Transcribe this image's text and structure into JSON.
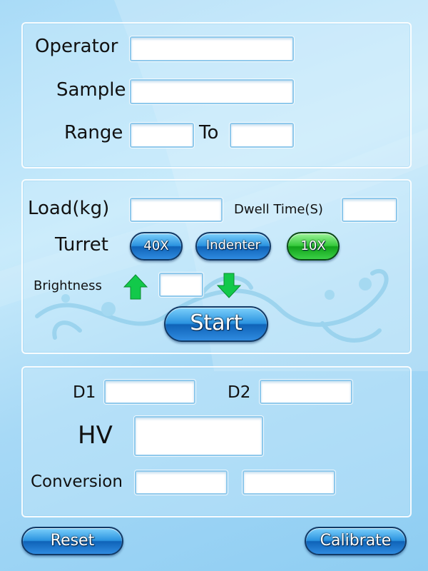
{
  "colors": {
    "background": "#a9dbf7",
    "button_blue": "#2b93e0",
    "button_green": "#35c93b",
    "arrow_green": "#12c94a"
  },
  "setup": {
    "operator_label": "Operator",
    "operator_value": "",
    "sample_label": "Sample",
    "sample_value": "",
    "range_label": "Range",
    "range_from_value": "",
    "range_to_label": "To",
    "range_to_value": ""
  },
  "controls": {
    "load_label": "Load(kg)",
    "load_value": "",
    "dwell_label": "Dwell Time(S)",
    "dwell_value": "",
    "turret_label": "Turret",
    "turret_buttons": [
      "40X",
      "Indenter",
      "10X"
    ],
    "turret_active": "10X",
    "brightness_label": "Brightness",
    "brightness_value": "",
    "brightness_up_icon": "arrow-up-icon",
    "brightness_down_icon": "arrow-down-icon",
    "start_label": "Start"
  },
  "results": {
    "d1_label": "D1",
    "d1_value": "",
    "d2_label": "D2",
    "d2_value": "",
    "hv_label": "HV",
    "hv_value": "",
    "conversion_label": "Conversion",
    "conversion_value_1": "",
    "conversion_value_2": ""
  },
  "footer": {
    "reset_label": "Reset",
    "calibrate_label": "Calibrate"
  }
}
